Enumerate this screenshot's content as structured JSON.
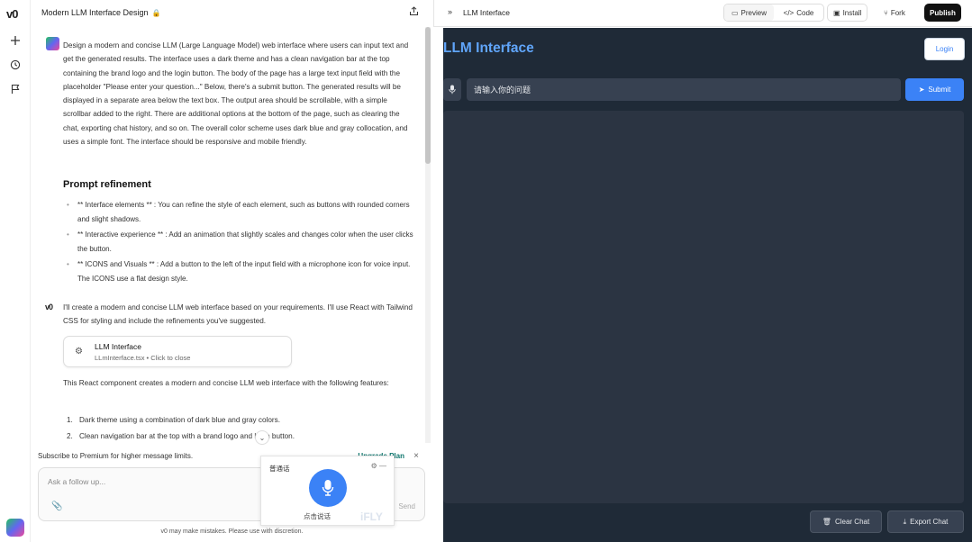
{
  "rail": {
    "logo": "v0"
  },
  "chat": {
    "title": "Modern LLM Interface Design",
    "user_message": "Design a modern and concise LLM (Large Language Model) web interface where users can input text and get the generated results. The interface uses a dark theme and has a clean navigation bar at the top containing the brand logo and the login button. The body of the page has a large text input field with the placeholder \"Please enter your question...\" Below, there's a submit button. The generated results will be displayed in a separate area below the text box. The output area should be scrollable, with a simple scrollbar added to the right. There are additional options at the bottom of the page, such as clearing the chat, exporting chat history, and so on. The overall color scheme uses dark blue and gray collocation, and uses a simple font. The interface should be responsive and mobile friendly.",
    "refine_heading": "Prompt refinement",
    "refine_items": [
      "** Interface elements ** : You can refine the style of each element, such as buttons with rounded corners and slight shadows.",
      "** Interactive experience ** : Add an animation that slightly scales and changes color when the user clicks the button.",
      "** ICONS and Visuals ** : Add a button to the left of the input field with a microphone icon for voice input. The ICONS use a flat design style."
    ],
    "reply": "I'll create a modern and concise LLM web interface based on your requirements. I'll use React with Tailwind CSS for styling and include the refinements you've suggested.",
    "card_title": "LLM Interface",
    "card_sub": "LLmInterface.tsx • Click to close",
    "para2": "This React component creates a modern and concise LLM web interface with the following features:",
    "features": [
      {
        "n": "1.",
        "text": "Dark theme using a combination of dark blue and gray colors."
      },
      {
        "n": "2.",
        "text": "Clean navigation bar at the top with a brand logo and login button."
      }
    ],
    "premium_text": "Subscribe to Premium for higher message limits.",
    "upgrade_label": "Upgrade Plan",
    "composer_placeholder": "Ask a follow up...",
    "send_label": "Send",
    "footnote": "v0 may make mistakes. Please use with discretion."
  },
  "voice": {
    "label": "普通话",
    "hint": "点击说话",
    "brand": "iFLY"
  },
  "topbar": {
    "title": "LLM Interface",
    "preview": "Preview",
    "code": "Code",
    "install": "Install",
    "fork": "Fork",
    "publish": "Publish"
  },
  "app": {
    "brand": "LLM Interface",
    "login": "Login",
    "prompt_value": "请输入你的问题",
    "submit": "Submit",
    "clear": "Clear Chat",
    "export": "Export Chat",
    "colors": {
      "bg": "#1f2a37",
      "accent": "#3b82f6",
      "brand": "#60a5fa"
    }
  }
}
